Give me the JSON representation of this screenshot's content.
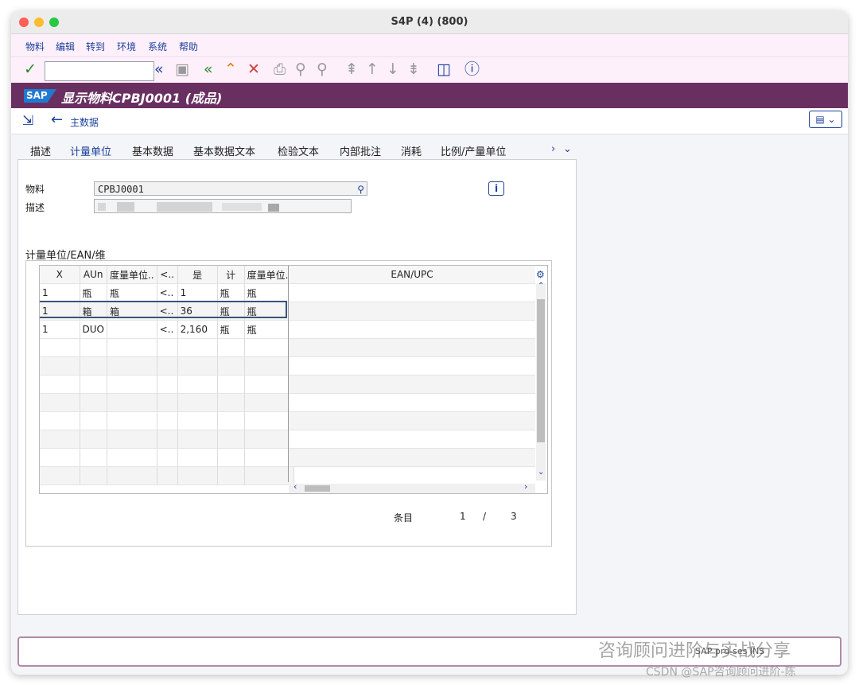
{
  "window": {
    "title": "S4P (4) (800)"
  },
  "menu": [
    "物料",
    "编辑",
    "转到",
    "环境",
    "系统",
    "帮助"
  ],
  "toolbar": {
    "command_value": ""
  },
  "header": {
    "logo": "SAP",
    "title": "显示物料CPBJ0001 (成品)"
  },
  "subbar": {
    "back_label": "主数据"
  },
  "tabs": [
    "描述",
    "计量单位",
    "基本数据",
    "基本数据文本",
    "检验文本",
    "内部批注",
    "消耗",
    "比例/产量单位"
  ],
  "active_tab": "计量单位",
  "form": {
    "material_label": "物料",
    "material_value": "CPBJ0001",
    "desc_label": "描述",
    "desc_value": ""
  },
  "uom": {
    "group_title": "计量单位/EAN/维",
    "columns": [
      "X",
      "AUn",
      "度量单位..",
      "<..",
      "是",
      "计",
      "度量单位.."
    ],
    "rows": [
      [
        "1",
        "瓶",
        "瓶",
        "<..",
        "1",
        "瓶",
        "瓶"
      ],
      [
        "1",
        "箱",
        "箱",
        "<..",
        "36",
        "瓶",
        "瓶"
      ],
      [
        "1",
        "DUO",
        "",
        "<..",
        "2,160",
        "瓶",
        "瓶"
      ]
    ],
    "ean_header": "EAN/UPC",
    "entries_label": "条目",
    "entry_current": "1",
    "entry_sep": "/",
    "entry_total": "3"
  },
  "watermark": {
    "line1": "咨询顾问进阶与实战分享",
    "line2": "CSDN @SAP咨询顾问进阶-陈",
    "status_text": "SAP   prd-ses INS"
  }
}
